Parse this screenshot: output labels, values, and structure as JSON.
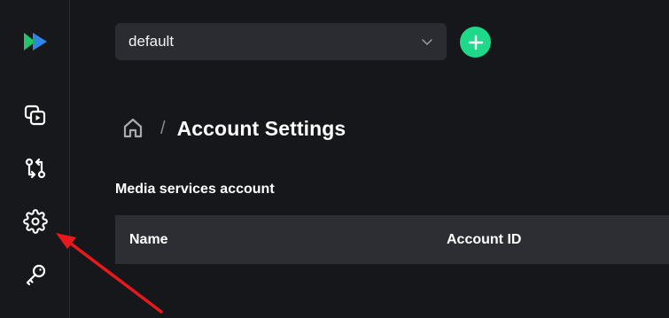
{
  "sidebar": {
    "logo": "app-logo",
    "items": [
      {
        "icon": "media-icon",
        "label": "Media"
      },
      {
        "icon": "sync-icon",
        "label": "Transfers"
      },
      {
        "icon": "gear-icon",
        "label": "Settings"
      },
      {
        "icon": "key-icon",
        "label": "Keys"
      }
    ]
  },
  "header": {
    "account_select": {
      "value": "default"
    },
    "add_button_icon": "plus-icon"
  },
  "breadcrumb": {
    "separator": "/",
    "current": "Account Settings"
  },
  "section": {
    "title": "Media services account",
    "table": {
      "columns": [
        "Name",
        "Account ID"
      ],
      "rows": []
    }
  },
  "colors": {
    "accent": "#1fd98a",
    "logo_green": "#23c26b",
    "logo_blue": "#2f86e8",
    "annotation_arrow": "#e8191c"
  }
}
